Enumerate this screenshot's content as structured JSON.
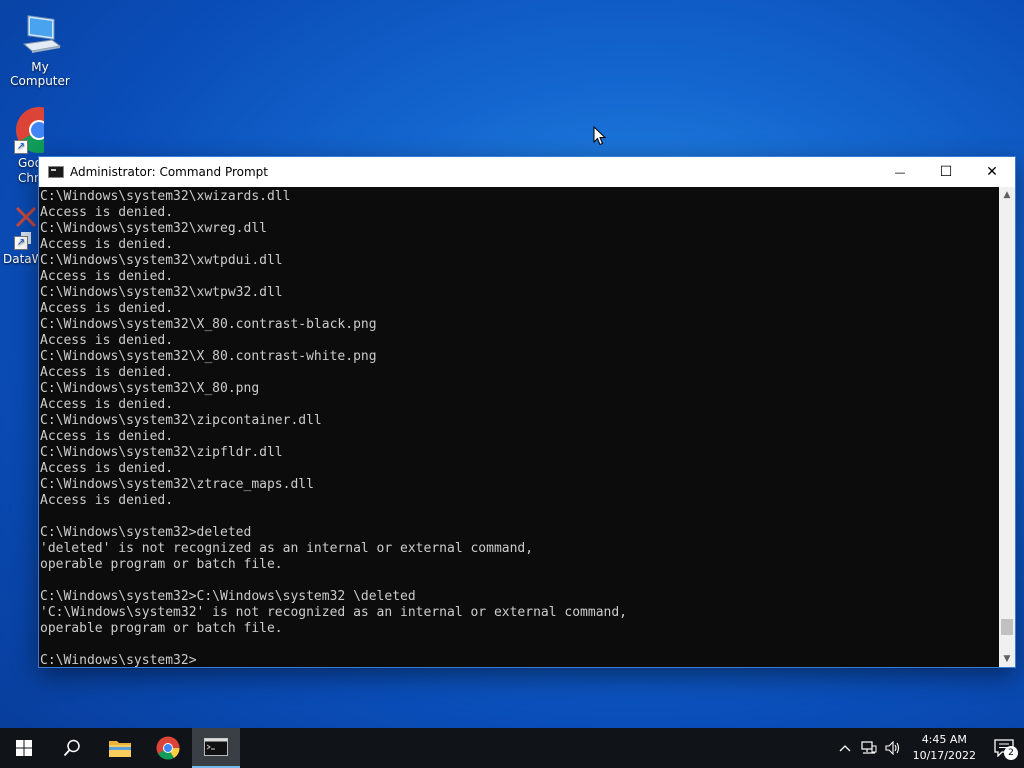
{
  "desktop": {
    "icons": [
      {
        "label": "My Computer",
        "icon": "computer-icon"
      },
      {
        "label": "Goo\nChr",
        "icon": "chrome-icon"
      },
      {
        "label": "DataW",
        "icon": "datawrapper-icon"
      }
    ]
  },
  "window": {
    "title": "Administrator: Command Prompt",
    "controls": {
      "minimize": "—",
      "maximize": "☐",
      "close": "✕"
    },
    "console_lines": [
      "C:\\Windows\\system32\\xwizards.dll",
      "Access is denied.",
      "C:\\Windows\\system32\\xwreg.dll",
      "Access is denied.",
      "C:\\Windows\\system32\\xwtpdui.dll",
      "Access is denied.",
      "C:\\Windows\\system32\\xwtpw32.dll",
      "Access is denied.",
      "C:\\Windows\\system32\\X_80.contrast-black.png",
      "Access is denied.",
      "C:\\Windows\\system32\\X_80.contrast-white.png",
      "Access is denied.",
      "C:\\Windows\\system32\\X_80.png",
      "Access is denied.",
      "C:\\Windows\\system32\\zipcontainer.dll",
      "Access is denied.",
      "C:\\Windows\\system32\\zipfldr.dll",
      "Access is denied.",
      "C:\\Windows\\system32\\ztrace_maps.dll",
      "Access is denied.",
      "",
      "C:\\Windows\\system32>deleted",
      "'deleted' is not recognized as an internal or external command,",
      "operable program or batch file.",
      "",
      "C:\\Windows\\system32>C:\\Windows\\system32 \\deleted",
      "'C:\\Windows\\system32' is not recognized as an internal or external command,",
      "operable program or batch file.",
      "",
      "C:\\Windows\\system32>"
    ]
  },
  "taskbar": {
    "clock_time": "4:45 AM",
    "clock_date": "10/17/2022",
    "notification_count": "2",
    "accent_color": "#76b9ed"
  }
}
